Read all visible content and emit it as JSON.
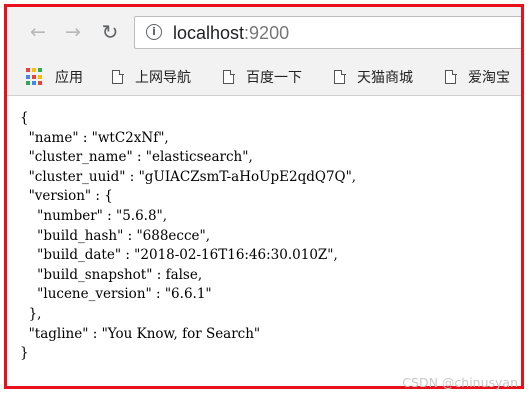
{
  "browser": {
    "nav": {
      "back_icon": "back-arrow-icon",
      "forward_icon": "forward-arrow-icon",
      "reload_icon": "reload-icon"
    },
    "address": {
      "host": "localhost",
      "port": ":9200",
      "security_icon": "info-icon"
    },
    "bookmarks": [
      {
        "label": "应用",
        "icon": "apps-grid-icon"
      },
      {
        "label": "上网导航",
        "icon": "page-icon"
      },
      {
        "label": "百度一下",
        "icon": "page-icon"
      },
      {
        "label": "天猫商城",
        "icon": "page-icon"
      },
      {
        "label": "爱淘宝",
        "icon": "page-icon"
      }
    ]
  },
  "page": {
    "json_lines": [
      "{",
      "  \"name\" : \"wtC2xNf\",",
      "  \"cluster_name\" : \"elasticsearch\",",
      "  \"cluster_uuid\" : \"gUIACZsmT-aHoUpE2qdQ7Q\",",
      "  \"version\" : {",
      "    \"number\" : \"5.6.8\",",
      "    \"build_hash\" : \"688ecce\",",
      "    \"build_date\" : \"2018-02-16T16:46:30.010Z\",",
      "    \"build_snapshot\" : false,",
      "    \"lucene_version\" : \"6.6.1\"",
      "  },",
      "  \"tagline\" : \"You Know, for Search\"",
      "}"
    ]
  },
  "watermark": "CSDN @chinusyan",
  "colors": {
    "frame_border": "#e8101a",
    "toolbar_bg": "#f2f2f2",
    "apps_icon": [
      "#ea4335",
      "#fbbc05",
      "#34a853",
      "#4285f4"
    ]
  }
}
